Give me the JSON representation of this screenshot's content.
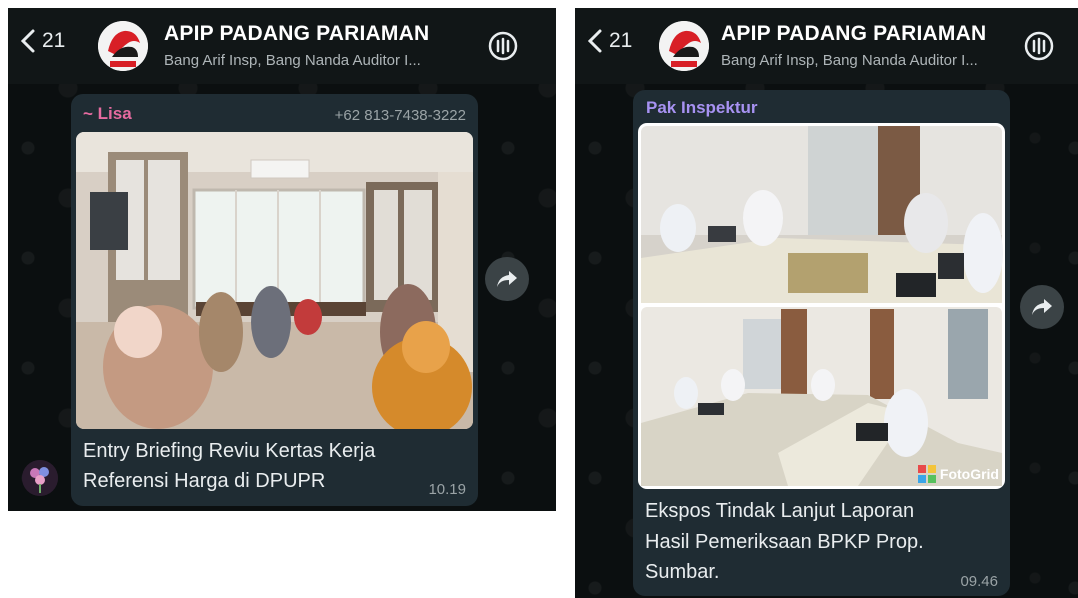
{
  "screens": [
    {
      "header": {
        "back_count": "21",
        "title": "APIP PADANG PARIAMAN",
        "subtitle": "Bang Arif Insp, Bang Nanda Auditor I..."
      },
      "message": {
        "sender": "~ Lisa",
        "phone": "+62 813-7438-3222",
        "caption_line1": "Entry Briefing Reviu Kertas Kerja",
        "caption_line2": "Referensi Harga di DPUPR",
        "time": "10.19"
      }
    },
    {
      "header": {
        "back_count": "21",
        "title": "APIP PADANG PARIAMAN",
        "subtitle": "Bang Arif Insp, Bang Nanda Auditor I..."
      },
      "message": {
        "sender": "Pak Inspektur",
        "caption_line1": "Ekspos Tindak Lanjut Laporan",
        "caption_line2": "Hasil Pemeriksaan BPKP Prop.",
        "caption_line3": "Sumbar.",
        "watermark": "FotoGrid",
        "time": "09.46"
      }
    }
  ],
  "icons": [
    "back-chevron-icon",
    "group-avatar",
    "call-icon",
    "forward-icon"
  ],
  "colors": {
    "sender_lisa": "#e66ba0",
    "sender_inspektur": "#a792f2",
    "bubble": "#1f2c33",
    "chat_bg": "#0b0f10"
  }
}
